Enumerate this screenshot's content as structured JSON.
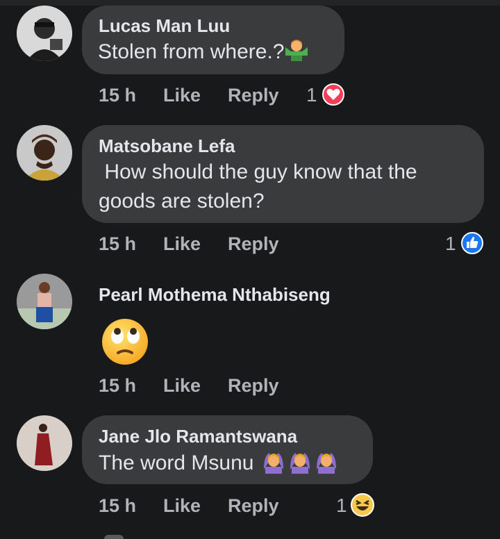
{
  "comments": [
    {
      "author": "Lucas Man Luu",
      "text": "Stolen from where.?",
      "time": "15 h",
      "like_label": "Like",
      "reply_label": "Reply",
      "reaction_count": "1",
      "reaction": "heart-icon"
    },
    {
      "author": "Matsobane Lefa",
      "text_line1": " How should the guy know that the",
      "text_line2": "goods are stolen?",
      "time": "15 h",
      "like_label": "Like",
      "reply_label": "Reply",
      "reaction_count": "1",
      "reaction": "thumbs-up-icon"
    },
    {
      "author": "Pearl Mothema Nthabiseng",
      "emoji": "face-with-rolling-eyes-icon",
      "time": "15 h",
      "like_label": "Like",
      "reply_label": "Reply"
    },
    {
      "author": "Jane Jlo Ramantswana",
      "text": "The word Msunu",
      "time": "15 h",
      "like_label": "Like",
      "reply_label": "Reply",
      "reaction_count": "1",
      "reaction": "laughing-face-icon"
    }
  ],
  "colors": {
    "background": "#18191a",
    "bubble": "#3a3b3c",
    "text": "#e4e6eb",
    "meta": "#b0b3b8",
    "like_blue": "#1877f2",
    "love_red": "#f33e58"
  }
}
